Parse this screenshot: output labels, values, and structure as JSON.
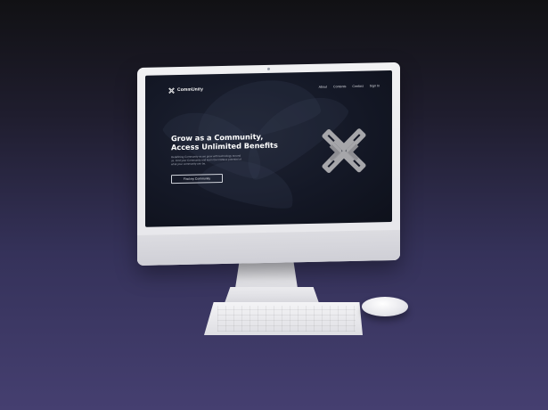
{
  "site": {
    "brand_name": "CommUnity",
    "nav": [
      "About",
      "Contents",
      "Contact",
      "Sign In"
    ],
    "hero_line1": "Grow as a Community,",
    "hero_line2": "Access Unlimited Benefits",
    "hero_description": "Redefining Community as we grow with technology around us. Find your Community and learn the limitless potential of what your community can be.",
    "cta_label": "Find my Community"
  },
  "colors": {
    "screen_bg": "#141826",
    "logo_mark": "#a6a6aa",
    "text_primary": "#ffffff"
  },
  "icons": {
    "brand": "interlocked-chain-icon",
    "hero_logo": "interlocked-chain-logo"
  }
}
